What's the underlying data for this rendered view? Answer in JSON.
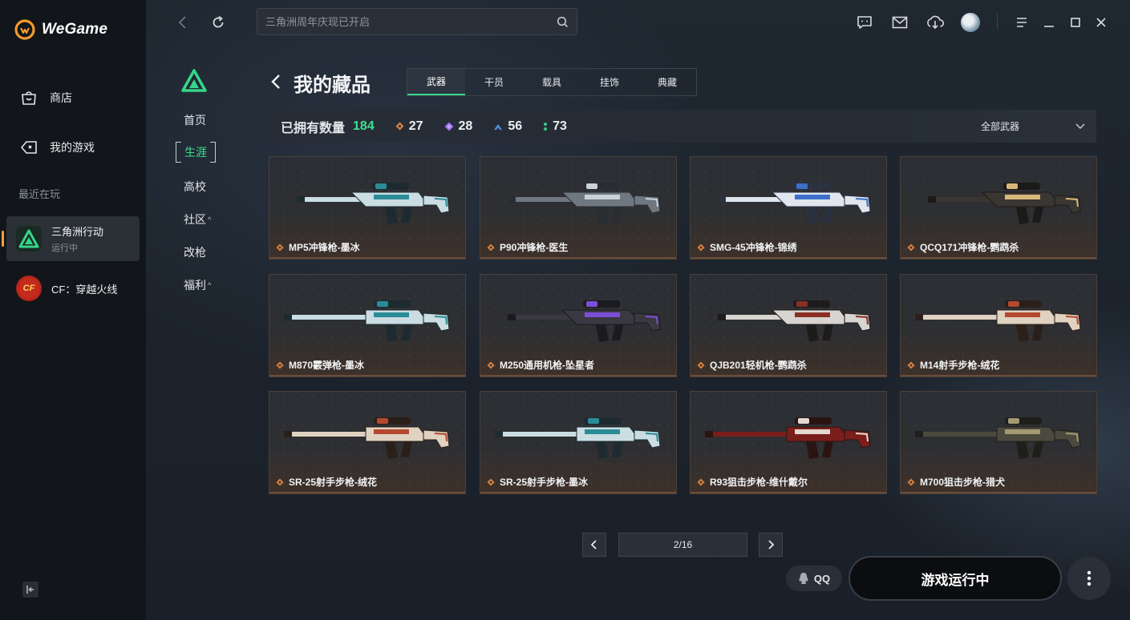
{
  "brand": {
    "name": "WeGame"
  },
  "sidebar": {
    "nav": [
      {
        "label": "商店",
        "icon": "shop-bag-icon"
      },
      {
        "label": "我的游戏",
        "icon": "gamepad-icon"
      }
    ],
    "recent_title": "最近在玩",
    "games": [
      {
        "name": "三角洲行动",
        "status": "运行中",
        "active": true
      },
      {
        "name": "CF：穿越火线",
        "status": "",
        "active": false
      }
    ]
  },
  "topbar": {
    "search_placeholder": "三角洲周年庆现已开启"
  },
  "subnav": {
    "items": [
      {
        "label": "首页",
        "caret": ""
      },
      {
        "label": "生涯",
        "caret": "",
        "active": true
      },
      {
        "label": "高校",
        "caret": ""
      },
      {
        "label": "社区",
        "caret": "^"
      },
      {
        "label": "改枪",
        "caret": ""
      },
      {
        "label": "福利",
        "caret": "^"
      }
    ]
  },
  "page": {
    "title": "我的藏品",
    "tabs": [
      "武器",
      "干员",
      "载具",
      "挂饰",
      "典藏"
    ],
    "active_tab": "武器"
  },
  "stats": {
    "label": "已拥有数量",
    "total": "184",
    "counts": [
      {
        "value": "27",
        "color": "#d9803f"
      },
      {
        "value": "28",
        "color": "#9b6cf0"
      },
      {
        "value": "56",
        "color": "#4d8fe0"
      },
      {
        "value": "73",
        "color": "#3ec48a"
      }
    ],
    "filter_label": "全部武器"
  },
  "items": [
    {
      "name": "MP5冲锋枪-墨冰",
      "theme": "ice"
    },
    {
      "name": "P90冲锋枪-医生",
      "theme": "doctor"
    },
    {
      "name": "SMG-45冲锋枪-锦绣",
      "theme": "blue"
    },
    {
      "name": "QCQ171冲锋枪-鹦鹉杀",
      "theme": "gold"
    },
    {
      "name": "M870霰弹枪-墨冰",
      "theme": "ice"
    },
    {
      "name": "M250通用机枪-坠星者",
      "theme": "purple"
    },
    {
      "name": "QJB201轻机枪-鹦鹉杀",
      "theme": "white"
    },
    {
      "name": "M14射手步枪-绒花",
      "theme": "red"
    },
    {
      "name": "SR-25射手步枪-绒花",
      "theme": "red"
    },
    {
      "name": "SR-25射手步枪-墨冰",
      "theme": "ice"
    },
    {
      "name": "R93狙击步枪-维什戴尔",
      "theme": "crimson"
    },
    {
      "name": "M700狙击步枪-猎犬",
      "theme": "olive"
    }
  ],
  "pager": {
    "text": "2/16"
  },
  "bottom": {
    "qq_label": "QQ",
    "launch_label": "游戏运行中"
  },
  "colors": {
    "accent_green": "#3ee08e",
    "rarity_orange": "#d9803f",
    "card_border": "#4a4039"
  }
}
